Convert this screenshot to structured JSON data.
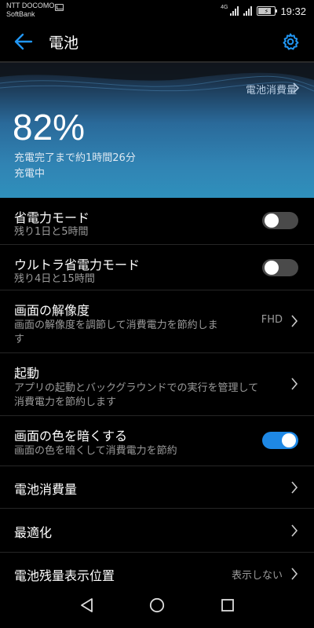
{
  "status_bar": {
    "carrier_1": "NTT DOCOMO",
    "carrier_2": "SoftBank",
    "network": "4G",
    "time": "19:32"
  },
  "app_bar": {
    "title": "電池",
    "back_icon": "arrow-back-icon",
    "settings_icon": "gear-icon",
    "accent_color": "#2196f3"
  },
  "header": {
    "usage_link": "電池消費量",
    "percent": "82%",
    "time_to_full": "充電完了まで約1時間26分",
    "status": "充電中",
    "level": 0.82
  },
  "items": [
    {
      "title": "省電力モード",
      "subtitle": "残り1日と5時間",
      "control": "toggle",
      "on": false
    },
    {
      "title": "ウルトラ省電力モード",
      "subtitle": "残り4日と15時間",
      "control": "toggle",
      "on": false
    },
    {
      "title": "画面の解像度",
      "subtitle_line1": "画面の解像度を調節して消費電力を節約しま",
      "subtitle_line2": "す",
      "value": "FHD",
      "control": "chevron"
    },
    {
      "title": "起動",
      "subtitle_line1": "アプリの起動とバックグラウンドでの実行を管理して",
      "subtitle_line2": "消費電力を節約します",
      "control": "chevron"
    },
    {
      "title": "画面の色を暗くする",
      "subtitle": "画面の色を暗くして消費電力を節約",
      "control": "toggle",
      "on": true
    },
    {
      "title": "電池消費量",
      "control": "chevron"
    },
    {
      "title": "最適化",
      "control": "chevron"
    },
    {
      "title": "電池残量表示位置",
      "value": "表示しない",
      "control": "chevron"
    }
  ],
  "nav_bar": {
    "back_icon": "triangle-back-icon",
    "home_icon": "circle-home-icon",
    "recents_icon": "square-recents-icon"
  }
}
